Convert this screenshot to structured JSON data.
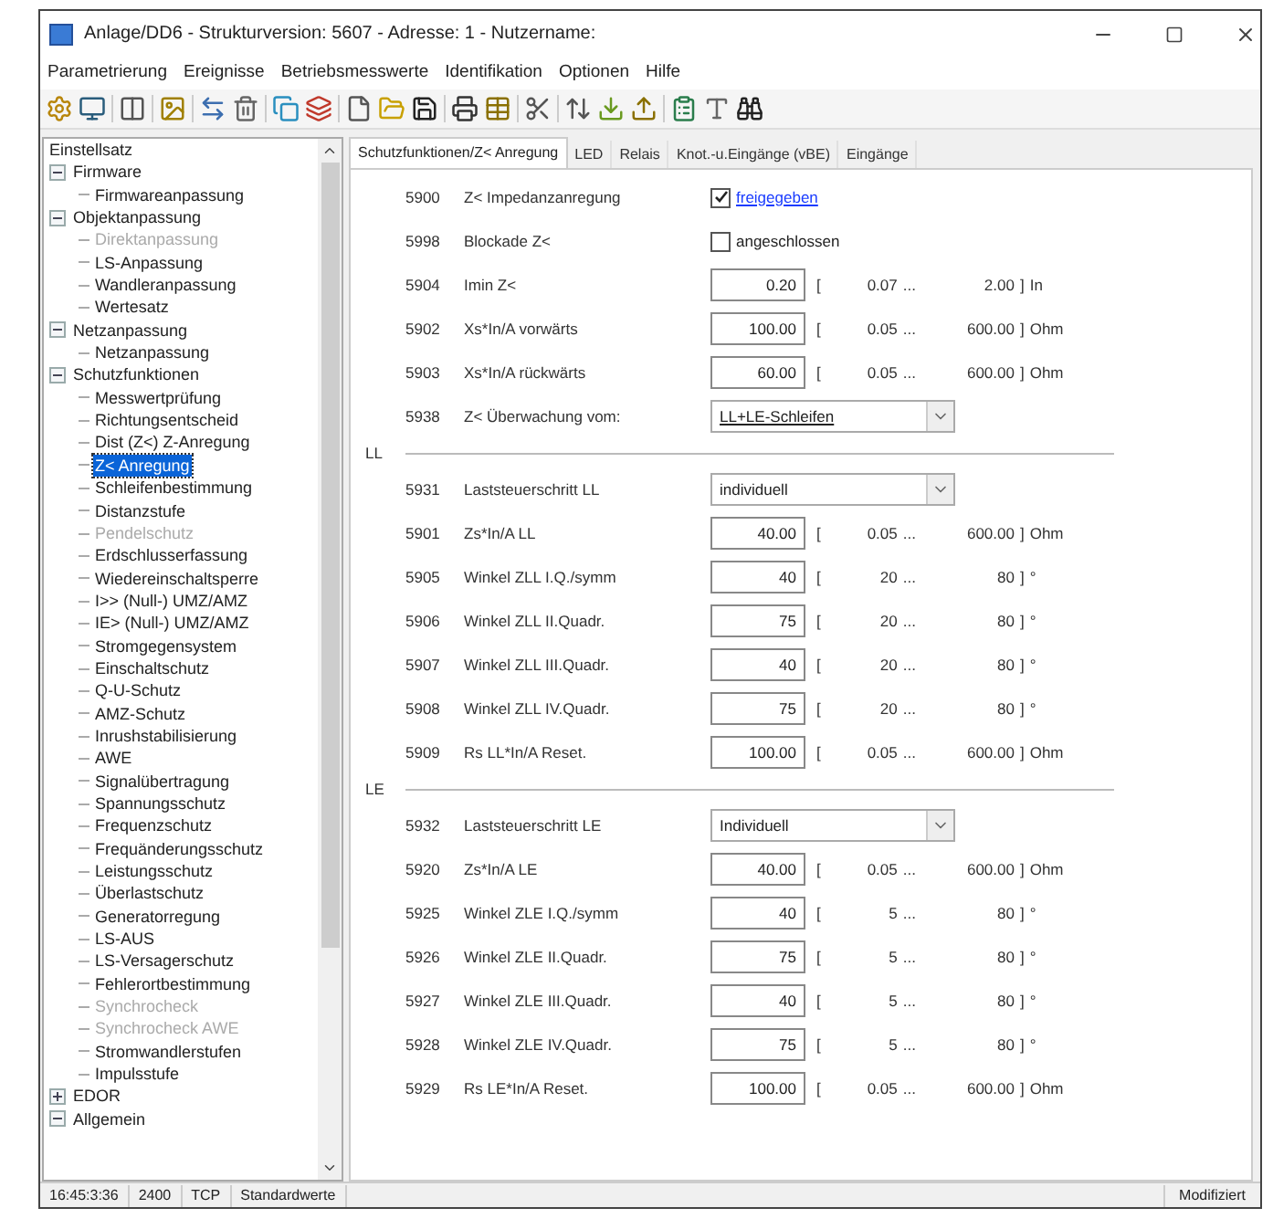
{
  "window": {
    "title": "Anlage/DD6 - Strukturversion: 5607 - Adresse: 1 - Nutzername:"
  },
  "menu": [
    "Parametrierung",
    "Ereignisse",
    "Betriebsmesswerte",
    "Identifikation",
    "Optionen",
    "Hilfe"
  ],
  "tree": {
    "header": "Einstellsatz",
    "items": [
      {
        "label": "Firmware",
        "expanded": true,
        "children": [
          {
            "label": "Firmwareanpassung",
            "disabled": false,
            "selected": false
          }
        ]
      },
      {
        "label": "Objektanpassung",
        "expanded": true,
        "children": [
          {
            "label": "Direktanpassung",
            "disabled": true,
            "selected": false
          },
          {
            "label": "LS-Anpassung",
            "disabled": false,
            "selected": false
          },
          {
            "label": "Wandleranpassung",
            "disabled": false,
            "selected": false
          },
          {
            "label": "Wertesatz",
            "disabled": false,
            "selected": false
          }
        ]
      },
      {
        "label": "Netzanpassung",
        "expanded": true,
        "children": [
          {
            "label": "Netzanpassung",
            "disabled": false,
            "selected": false
          }
        ]
      },
      {
        "label": "Schutzfunktionen",
        "expanded": true,
        "children": [
          {
            "label": "Messwertprüfung",
            "disabled": false,
            "selected": false
          },
          {
            "label": "Richtungsentscheid",
            "disabled": false,
            "selected": false
          },
          {
            "label": "Dist (Z<) Z-Anregung",
            "disabled": false,
            "selected": false
          },
          {
            "label": "Z< Anregung",
            "disabled": false,
            "selected": true
          },
          {
            "label": "Schleifenbestimmung",
            "disabled": false,
            "selected": false
          },
          {
            "label": "Distanzstufe",
            "disabled": false,
            "selected": false
          },
          {
            "label": "Pendelschutz",
            "disabled": true,
            "selected": false
          },
          {
            "label": "Erdschlusserfassung",
            "disabled": false,
            "selected": false
          },
          {
            "label": "Wiedereinschaltsperre",
            "disabled": false,
            "selected": false
          },
          {
            "label": "I>> (Null-) UMZ/AMZ",
            "disabled": false,
            "selected": false
          },
          {
            "label": "IE> (Null-) UMZ/AMZ",
            "disabled": false,
            "selected": false
          },
          {
            "label": "Stromgegensystem",
            "disabled": false,
            "selected": false
          },
          {
            "label": "Einschaltschutz",
            "disabled": false,
            "selected": false
          },
          {
            "label": "Q-U-Schutz",
            "disabled": false,
            "selected": false
          },
          {
            "label": "AMZ-Schutz",
            "disabled": false,
            "selected": false
          },
          {
            "label": "Inrushstabilisierung",
            "disabled": false,
            "selected": false
          },
          {
            "label": "AWE",
            "disabled": false,
            "selected": false
          },
          {
            "label": "Signalübertragung",
            "disabled": false,
            "selected": false
          },
          {
            "label": "Spannungsschutz",
            "disabled": false,
            "selected": false
          },
          {
            "label": "Frequenzschutz",
            "disabled": false,
            "selected": false
          },
          {
            "label": "Frequänderungsschutz",
            "disabled": false,
            "selected": false
          },
          {
            "label": "Leistungsschutz",
            "disabled": false,
            "selected": false
          },
          {
            "label": "Überlastschutz",
            "disabled": false,
            "selected": false
          },
          {
            "label": "Generatorregung",
            "disabled": false,
            "selected": false
          },
          {
            "label": "LS-AUS",
            "disabled": false,
            "selected": false
          },
          {
            "label": "LS-Versagerschutz",
            "disabled": false,
            "selected": false
          },
          {
            "label": "Fehlerortbestimmung",
            "disabled": false,
            "selected": false
          },
          {
            "label": "Synchrocheck",
            "disabled": true,
            "selected": false
          },
          {
            "label": "Synchrocheck AWE",
            "disabled": true,
            "selected": false
          },
          {
            "label": "Stromwandlerstufen",
            "disabled": false,
            "selected": false
          },
          {
            "label": "Impulsstufe",
            "disabled": false,
            "selected": false
          }
        ]
      },
      {
        "label": "EDOR",
        "expanded": false
      },
      {
        "label": "Allgemein",
        "expanded": true
      }
    ]
  },
  "tabs": [
    {
      "label": "Schutzfunktionen/Z< Anregung",
      "selected": true
    },
    {
      "label": "LED",
      "selected": false
    },
    {
      "label": "Relais",
      "selected": false
    },
    {
      "label": "Knot.-u.Eingänge (vBE)",
      "selected": false
    },
    {
      "label": "Eingänge",
      "selected": false
    }
  ],
  "rows": [
    {
      "kind": "checkbox",
      "number": "5900",
      "label": "Z< Impedanzanregung",
      "checked": true,
      "text": "freigegeben",
      "link": true
    },
    {
      "kind": "checkbox",
      "number": "5998",
      "label": "Blockade Z<",
      "checked": false,
      "text": "angeschlossen",
      "link": false
    },
    {
      "kind": "number",
      "number": "5904",
      "label": "Imin Z<",
      "value": "0.20",
      "range_open": "[",
      "min": "0.07",
      "ellipsis": "...",
      "max": "2.00",
      "range_close": "]",
      "unit": "In"
    },
    {
      "kind": "number",
      "number": "5902",
      "label": "Xs*In/A vorwärts",
      "value": "100.00",
      "range_open": "[",
      "min": "0.05",
      "ellipsis": "...",
      "max": "600.00",
      "range_close": "]",
      "unit": "Ohm"
    },
    {
      "kind": "number",
      "number": "5903",
      "label": "Xs*In/A rückwärts",
      "value": "60.00",
      "range_open": "[",
      "min": "0.05",
      "ellipsis": "...",
      "max": "600.00",
      "range_close": "]",
      "unit": "Ohm"
    },
    {
      "kind": "select",
      "number": "5938",
      "label": "Z< Überwachung vom:",
      "value": "LL+LE-Schleifen",
      "underlined": true
    },
    {
      "kind": "group",
      "label": "LL"
    },
    {
      "kind": "select",
      "number": "5931",
      "label": "Laststeuerschritt LL",
      "value": "individuell",
      "underlined": false
    },
    {
      "kind": "number",
      "number": "5901",
      "label": "Zs*In/A LL",
      "value": "40.00",
      "range_open": "[",
      "min": "0.05",
      "ellipsis": "...",
      "max": "600.00",
      "range_close": "]",
      "unit": "Ohm"
    },
    {
      "kind": "number",
      "number": "5905",
      "label": "Winkel ZLL I.Q./symm",
      "value": "40",
      "range_open": "[",
      "min": "20",
      "ellipsis": "...",
      "max": "80",
      "range_close": "]",
      "unit": "°"
    },
    {
      "kind": "number",
      "number": "5906",
      "label": "Winkel ZLL II.Quadr.",
      "value": "75",
      "range_open": "[",
      "min": "20",
      "ellipsis": "...",
      "max": "80",
      "range_close": "]",
      "unit": "°"
    },
    {
      "kind": "number",
      "number": "5907",
      "label": "Winkel ZLL III.Quadr.",
      "value": "40",
      "range_open": "[",
      "min": "20",
      "ellipsis": "...",
      "max": "80",
      "range_close": "]",
      "unit": "°"
    },
    {
      "kind": "number",
      "number": "5908",
      "label": "Winkel ZLL IV.Quadr.",
      "value": "75",
      "range_open": "[",
      "min": "20",
      "ellipsis": "...",
      "max": "80",
      "range_close": "]",
      "unit": "°"
    },
    {
      "kind": "number",
      "number": "5909",
      "label": "Rs LL*In/A Reset.",
      "value": "100.00",
      "range_open": "[",
      "min": "0.05",
      "ellipsis": "...",
      "max": "600.00",
      "range_close": "]",
      "unit": "Ohm"
    },
    {
      "kind": "group",
      "label": "LE"
    },
    {
      "kind": "select",
      "number": "5932",
      "label": "Laststeuerschritt LE",
      "value": "Individuell",
      "underlined": false
    },
    {
      "kind": "number",
      "number": "5920",
      "label": "Zs*In/A LE",
      "value": "40.00",
      "range_open": "[",
      "min": "0.05",
      "ellipsis": "...",
      "max": "600.00",
      "range_close": "]",
      "unit": "Ohm"
    },
    {
      "kind": "number",
      "number": "5925",
      "label": "Winkel ZLE I.Q./symm",
      "value": "40",
      "range_open": "[",
      "min": "5",
      "ellipsis": "...",
      "max": "80",
      "range_close": "]",
      "unit": "°"
    },
    {
      "kind": "number",
      "number": "5926",
      "label": "Winkel ZLE II.Quadr.",
      "value": "75",
      "range_open": "[",
      "min": "5",
      "ellipsis": "...",
      "max": "80",
      "range_close": "]",
      "unit": "°"
    },
    {
      "kind": "number",
      "number": "5927",
      "label": "Winkel ZLE III.Quadr.",
      "value": "40",
      "range_open": "[",
      "min": "5",
      "ellipsis": "...",
      "max": "80",
      "range_close": "]",
      "unit": "°"
    },
    {
      "kind": "number",
      "number": "5928",
      "label": "Winkel ZLE IV.Quadr.",
      "value": "75",
      "range_open": "[",
      "min": "5",
      "ellipsis": "...",
      "max": "80",
      "range_close": "]",
      "unit": "°"
    },
    {
      "kind": "number",
      "number": "5929",
      "label": "Rs LE*In/A Reset.",
      "value": "100.00",
      "range_open": "[",
      "min": "0.05",
      "ellipsis": "...",
      "max": "600.00",
      "range_close": "]",
      "unit": "Ohm"
    }
  ],
  "status_bar": {
    "fields": [
      "16:45:3:36",
      "2400",
      "TCP",
      "Standardwerte"
    ],
    "right": "Modifiziert"
  }
}
